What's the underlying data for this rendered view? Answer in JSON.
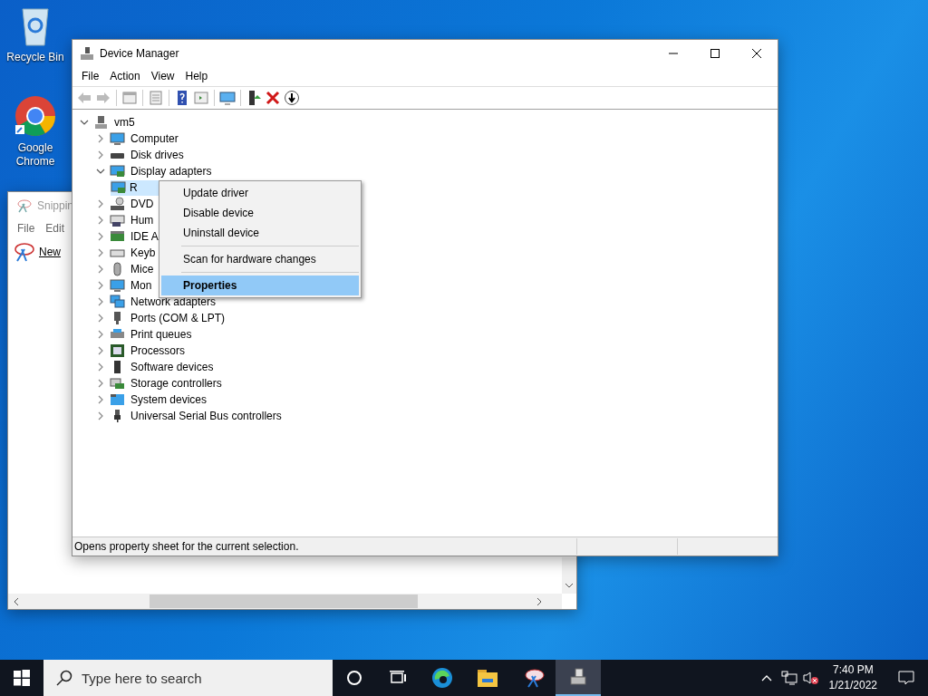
{
  "desktop_icons": [
    {
      "label": "Recycle Bin",
      "kind": "recycle"
    },
    {
      "label": "Google Chrome",
      "kind": "chrome"
    }
  ],
  "snipping_window": {
    "title": "Snippin",
    "menu": [
      "File",
      "Edit"
    ],
    "new_button": "New"
  },
  "device_manager": {
    "title": "Device Manager",
    "menu": [
      "File",
      "Action",
      "View",
      "Help"
    ],
    "tree": {
      "label": "vm5",
      "kind": "computer",
      "expanded": true,
      "children": [
        {
          "label": "Computer",
          "kind": "monitor",
          "expanded": false
        },
        {
          "label": "Disk drives",
          "kind": "disk",
          "expanded": false
        },
        {
          "label": "Display adapters",
          "kind": "display",
          "expanded": true,
          "children": [
            {
              "label": "R",
              "kind": "display",
              "selected": true
            }
          ]
        },
        {
          "label": "DVD",
          "kind": "dvd",
          "expanded": false
        },
        {
          "label": "Hum",
          "kind": "hid",
          "expanded": false
        },
        {
          "label": "IDE A",
          "kind": "ide",
          "expanded": false
        },
        {
          "label": "Keyb",
          "kind": "keyboard",
          "expanded": false
        },
        {
          "label": "Mice",
          "kind": "mouse",
          "expanded": false
        },
        {
          "label": "Mon",
          "kind": "monitor",
          "expanded": false
        },
        {
          "label": "Network adapters",
          "kind": "network",
          "expanded": false
        },
        {
          "label": "Ports (COM & LPT)",
          "kind": "port",
          "expanded": false
        },
        {
          "label": "Print queues",
          "kind": "printer",
          "expanded": false
        },
        {
          "label": "Processors",
          "kind": "chip",
          "expanded": false
        },
        {
          "label": "Software devices",
          "kind": "tower",
          "expanded": false
        },
        {
          "label": "Storage controllers",
          "kind": "storage",
          "expanded": false
        },
        {
          "label": "System devices",
          "kind": "system",
          "expanded": false
        },
        {
          "label": "Universal Serial Bus controllers",
          "kind": "usb",
          "expanded": false
        }
      ]
    },
    "context_menu": [
      {
        "kind": "item",
        "label": "Update driver",
        "selected": false
      },
      {
        "kind": "item",
        "label": "Disable device",
        "selected": false
      },
      {
        "kind": "item",
        "label": "Uninstall device",
        "selected": false
      },
      {
        "kind": "separator"
      },
      {
        "kind": "item",
        "label": "Scan for hardware changes",
        "selected": false
      },
      {
        "kind": "separator"
      },
      {
        "kind": "item",
        "label": "Properties",
        "selected": true
      }
    ],
    "status_bar": "Opens property sheet for the current selection."
  },
  "taskbar": {
    "search_placeholder": "Type here to search",
    "apps": [
      {
        "kind": "cortana",
        "active": false
      },
      {
        "kind": "taskview",
        "active": false
      },
      {
        "kind": "edge",
        "active": false
      },
      {
        "kind": "explorer",
        "active": false
      },
      {
        "kind": "snipping",
        "active": false
      },
      {
        "kind": "devmgr",
        "active": true
      }
    ],
    "time": "7:40 PM",
    "date": "1/21/2022"
  }
}
